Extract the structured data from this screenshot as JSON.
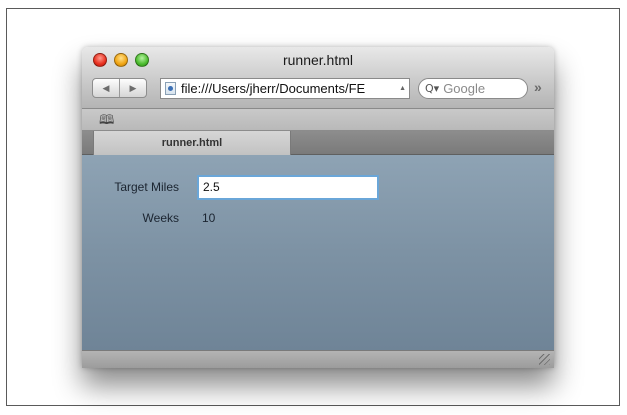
{
  "window": {
    "title": "runner.html"
  },
  "toolbar": {
    "back_icon": "◀",
    "forward_icon": "▶",
    "url": "file:///Users/jherr/Documents/FE",
    "search_placeholder": "Google",
    "search_icon": "Q▾",
    "overflow": "»"
  },
  "bookmarks": {
    "icon": "book-icon"
  },
  "tabs": [
    {
      "label": "runner.html",
      "active": true
    }
  ],
  "form": {
    "target_miles_label": "Target Miles",
    "target_miles_value": "2.5",
    "weeks_label": "Weeks",
    "weeks_value": "10"
  },
  "colors": {
    "content_background": "#7f94a6",
    "input_focus_ring": "#6aa6d8",
    "close_button": "#e8301f",
    "minimize_button": "#f0a514",
    "zoom_button": "#4cbc2e"
  }
}
